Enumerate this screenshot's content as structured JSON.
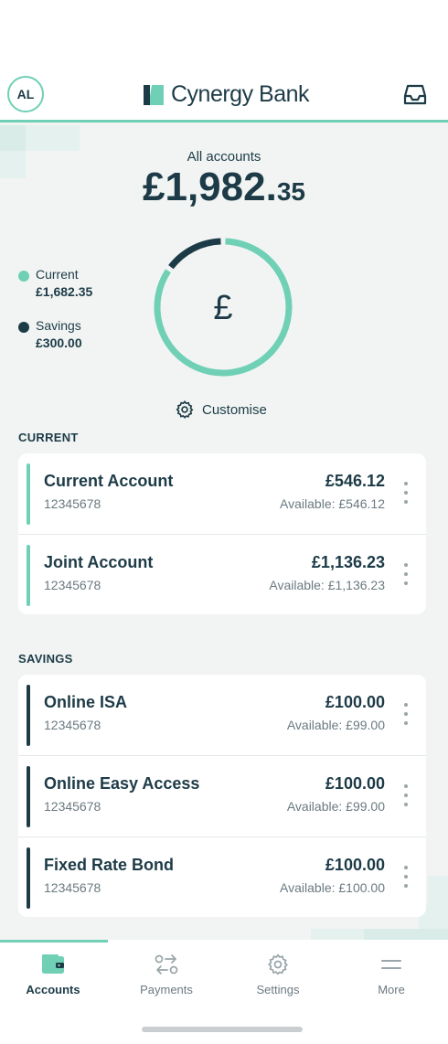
{
  "header": {
    "avatar_initials": "AL",
    "brand_name": "Cynergy Bank",
    "brand_color": "#6fd0b5",
    "inbox_icon": "inbox-icon"
  },
  "summary": {
    "label": "All accounts",
    "total_pounds": "£1,982.",
    "total_pence": "35",
    "legend": [
      {
        "label": "Current",
        "value": "£1,682.35",
        "color": "#6fd0b5"
      },
      {
        "label": "Savings",
        "value": "£300.00",
        "color": "#1d3b47"
      }
    ],
    "chart_center_symbol": "£",
    "customise_label": "Customise"
  },
  "chart_data": {
    "type": "pie",
    "title": "",
    "categories": [
      "Current",
      "Savings"
    ],
    "values": [
      1682.35,
      300.0
    ],
    "colors": [
      "#6fd0b5",
      "#1d3b47"
    ]
  },
  "current": {
    "title": "CURRENT",
    "accounts": [
      {
        "name": "Current Account",
        "number": "12345678",
        "balance": "£546.12",
        "available": "Available: £546.12"
      },
      {
        "name": "Joint Account",
        "number": "12345678",
        "balance": "£1,136.23",
        "available": "Available: £1,136.23"
      }
    ]
  },
  "savings": {
    "title": "SAVINGS",
    "accounts": [
      {
        "name": "Online ISA",
        "number": "12345678",
        "balance": "£100.00",
        "available": "Available: £99.00"
      },
      {
        "name": "Online Easy Access",
        "number": "12345678",
        "balance": "£100.00",
        "available": "Available: £99.00"
      },
      {
        "name": "Fixed Rate Bond",
        "number": "12345678",
        "balance": "£100.00",
        "available": "Available: £100.00"
      }
    ]
  },
  "nav": {
    "items": [
      {
        "label": "Accounts",
        "icon": "wallet-icon",
        "active": true
      },
      {
        "label": "Payments",
        "icon": "transfer-icon",
        "active": false
      },
      {
        "label": "Settings",
        "icon": "gear-icon",
        "active": false
      },
      {
        "label": "More",
        "icon": "menu-icon",
        "active": false
      }
    ]
  },
  "colors": {
    "accent": "#6fd0b5",
    "navy": "#1d3b47",
    "background": "#f1f4f3"
  }
}
